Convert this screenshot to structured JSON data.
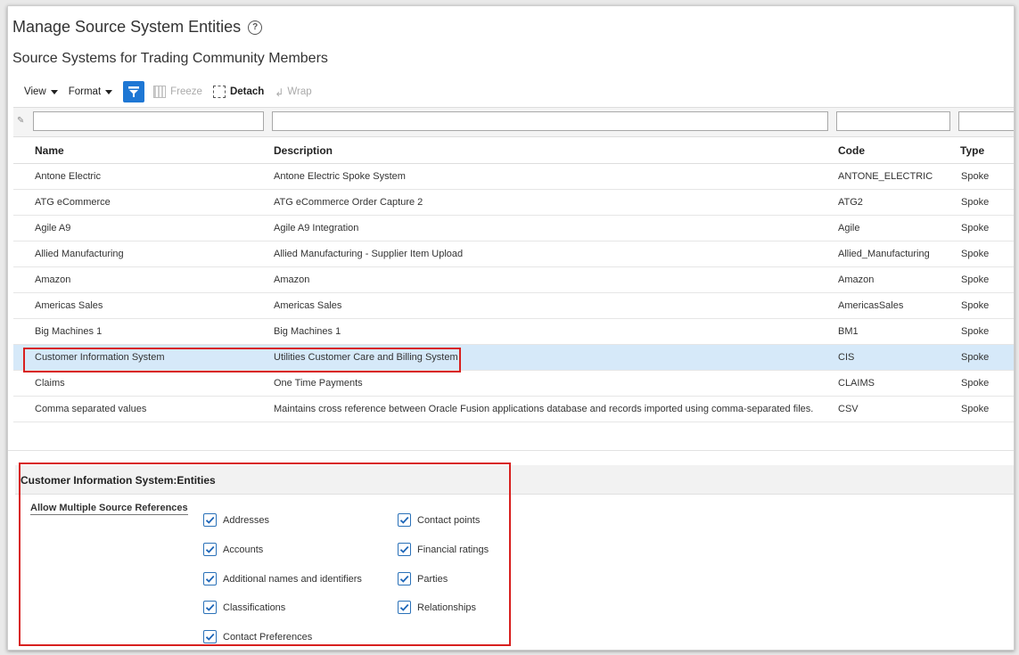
{
  "page": {
    "title": "Manage Source System Entities",
    "subtitle": "Source Systems for Trading Community Members"
  },
  "toolbar": {
    "view": "View",
    "format": "Format",
    "freeze": "Freeze",
    "detach": "Detach",
    "wrap": "Wrap"
  },
  "table": {
    "headers": {
      "name": "Name",
      "description": "Description",
      "code": "Code",
      "type": "Type"
    },
    "rows": [
      {
        "name": "Antone Electric",
        "description": "Antone Electric Spoke System",
        "code": "ANTONE_ELECTRIC",
        "type": "Spoke"
      },
      {
        "name": "ATG eCommerce",
        "description": "ATG eCommerce Order Capture 2",
        "code": "ATG2",
        "type": "Spoke"
      },
      {
        "name": "Agile A9",
        "description": "Agile A9 Integration",
        "code": "Agile",
        "type": "Spoke"
      },
      {
        "name": "Allied Manufacturing",
        "description": "Allied Manufacturing - Supplier Item Upload",
        "code": "Allied_Manufacturing",
        "type": "Spoke"
      },
      {
        "name": "Amazon",
        "description": "Amazon",
        "code": "Amazon",
        "type": "Spoke"
      },
      {
        "name": "Americas Sales",
        "description": "Americas Sales",
        "code": "AmericasSales",
        "type": "Spoke"
      },
      {
        "name": "Big Machines 1",
        "description": "Big Machines 1",
        "code": "BM1",
        "type": "Spoke"
      },
      {
        "name": "Customer Information System",
        "description": "Utilities Customer Care and Billing System",
        "code": "CIS",
        "type": "Spoke"
      },
      {
        "name": "Claims",
        "description": "One Time Payments",
        "code": "CLAIMS",
        "type": "Spoke"
      },
      {
        "name": "Comma separated values",
        "description": "Maintains cross reference between Oracle Fusion applications database and records imported using comma-separated files.",
        "code": "CSV",
        "type": "Spoke"
      }
    ]
  },
  "entities": {
    "title": "Customer Information System:Entities",
    "label": "Allow Multiple Source References",
    "left": [
      "Addresses",
      "Accounts",
      "Additional names and identifiers",
      "Classifications",
      "Contact Preferences"
    ],
    "right": [
      "Contact points",
      "Financial ratings",
      "Parties",
      "Relationships"
    ]
  }
}
